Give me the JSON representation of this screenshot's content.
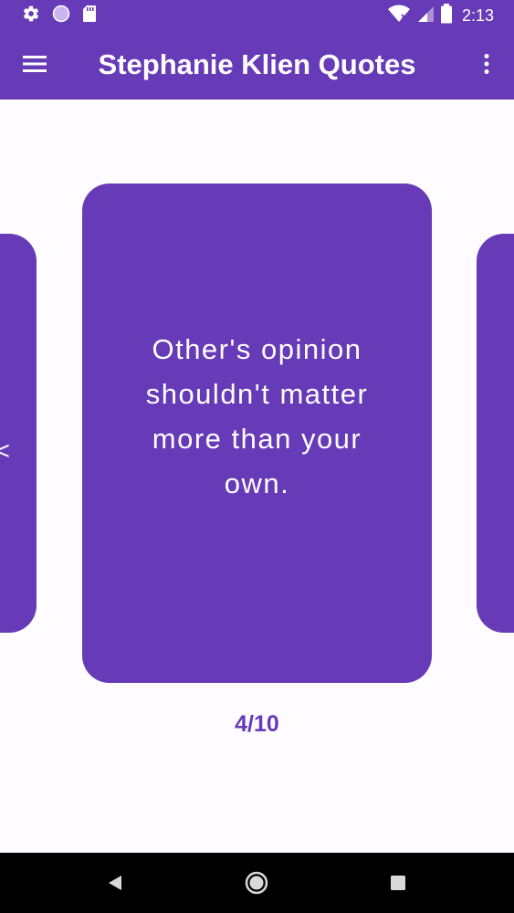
{
  "status_bar": {
    "time": "2:13",
    "icons": [
      "gear-icon",
      "circle-icon",
      "sd-card-icon",
      "wifi-icon",
      "signal-icon",
      "battery-icon"
    ]
  },
  "app_bar": {
    "title": "Stephanie Klien Quotes",
    "menu_icon": "hamburger-menu-icon",
    "overflow_icon": "more-vert-icon"
  },
  "carousel": {
    "current_quote": "Other's opinion shouldn't matter more than your own.",
    "previous_quote_fragment": "<",
    "current_index": 4,
    "total": 10,
    "indicator": "4/10"
  },
  "nav_bar": {
    "icons": [
      "back-icon",
      "home-icon",
      "recents-icon"
    ]
  },
  "colors": {
    "primary": "#673ab7",
    "background": "#fefcff",
    "nav_background": "#000000",
    "on_primary": "#ffffff"
  }
}
